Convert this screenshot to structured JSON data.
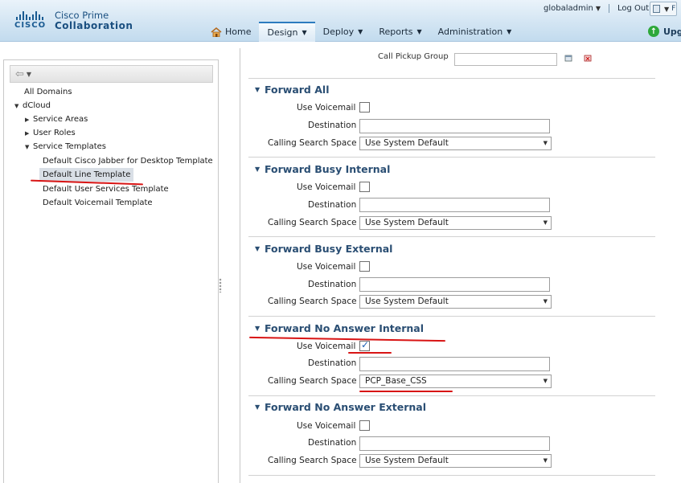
{
  "header": {
    "brand_word": "CISCO",
    "product_line1": "Cisco Prime",
    "product_line2": "Collaboration",
    "user": "globaladmin",
    "logout": "Log Out",
    "top_button": "F",
    "upgrade": "Upg"
  },
  "nav": [
    {
      "label": "Home",
      "icon": "home-icon"
    },
    {
      "label": "Design",
      "caret": "▼"
    },
    {
      "label": "Deploy",
      "caret": "▼"
    },
    {
      "label": "Reports",
      "caret": "▼"
    },
    {
      "label": "Administration",
      "caret": "▼"
    }
  ],
  "tree": {
    "items": [
      {
        "label": "All Domains"
      },
      {
        "label": "dCloud",
        "expanded": true
      },
      {
        "label": "Service Areas",
        "collapsed": true
      },
      {
        "label": "User Roles",
        "collapsed": true
      },
      {
        "label": "Service Templates",
        "expanded": true
      },
      {
        "label": "Default Cisco Jabber for Desktop Template"
      },
      {
        "label": "Default Line Template",
        "selected": true
      },
      {
        "label": "Default User Services Template"
      },
      {
        "label": "Default Voicemail Template"
      }
    ]
  },
  "form": {
    "top_field_label": "Call Pickup Group",
    "labels": {
      "voicemail": "Use Voicemail",
      "destination": "Destination",
      "css": "Calling Search Space"
    },
    "sections": [
      {
        "title": "Forward All",
        "voicemail_checked": false,
        "destination": "",
        "css": "Use System Default"
      },
      {
        "title": "Forward Busy Internal",
        "voicemail_checked": false,
        "destination": "",
        "css": "Use System Default"
      },
      {
        "title": "Forward Busy External",
        "voicemail_checked": false,
        "destination": "",
        "css": "Use System Default"
      },
      {
        "title": "Forward No Answer Internal",
        "voicemail_checked": true,
        "destination": "",
        "css": "PCP_Base_CSS"
      },
      {
        "title": "Forward No Answer External",
        "voicemail_checked": false,
        "destination": "",
        "css": "Use System Default"
      }
    ]
  },
  "colors": {
    "accent": "#2a4e73",
    "annotation": "#d81414",
    "checkmark": "#1b5fb4"
  }
}
